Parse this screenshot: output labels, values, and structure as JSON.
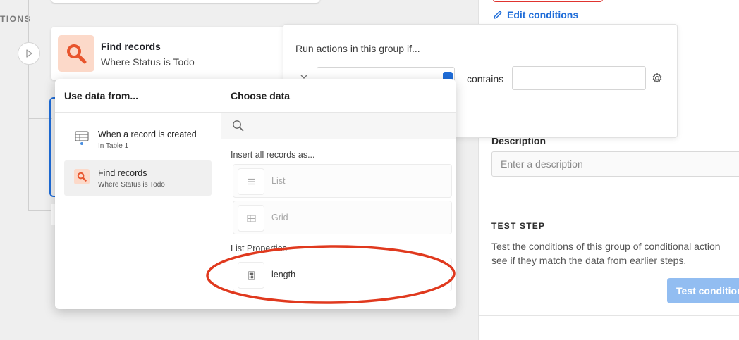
{
  "canvas": {
    "section_label": "TIONS",
    "step": {
      "title": "Find records",
      "subtitle": "Where Status is Todo",
      "icon": "search-icon",
      "accent": "#e8552d"
    }
  },
  "condition_group": {
    "heading": "Run actions in this group if...",
    "operator": "contains",
    "value": ""
  },
  "right_panel": {
    "edit_conditions_label": "Edit conditions",
    "description_label": "Description",
    "description_placeholder": "Enter a description",
    "test_step_title": "TEST STEP",
    "test_step_desc_line1": "Test the conditions of this group of conditional action",
    "test_step_desc_line2": "see if they match the data from earlier steps.",
    "test_button_label": "Test conditions",
    "link_color": "#1e6cd8"
  },
  "picker": {
    "left_header": "Use data from...",
    "right_header": "Choose data",
    "search_value": "",
    "sources": [
      {
        "title": "When a record is created",
        "subtitle": "In Table 1",
        "icon": "table-trigger-icon",
        "active": false
      },
      {
        "title": "Find records",
        "subtitle": "Where Status is Todo",
        "icon": "search-icon",
        "active": true
      }
    ],
    "insert_section_label": "Insert all records as...",
    "insert_options": [
      {
        "label": "List",
        "icon": "list-icon",
        "enabled": false
      },
      {
        "label": "Grid",
        "icon": "grid-icon",
        "enabled": false
      }
    ],
    "list_properties_label": "List Properties",
    "list_properties": [
      {
        "label": "length",
        "icon": "calculator-icon",
        "enabled": true
      }
    ]
  },
  "annotation": {
    "color": "#e0391e"
  }
}
